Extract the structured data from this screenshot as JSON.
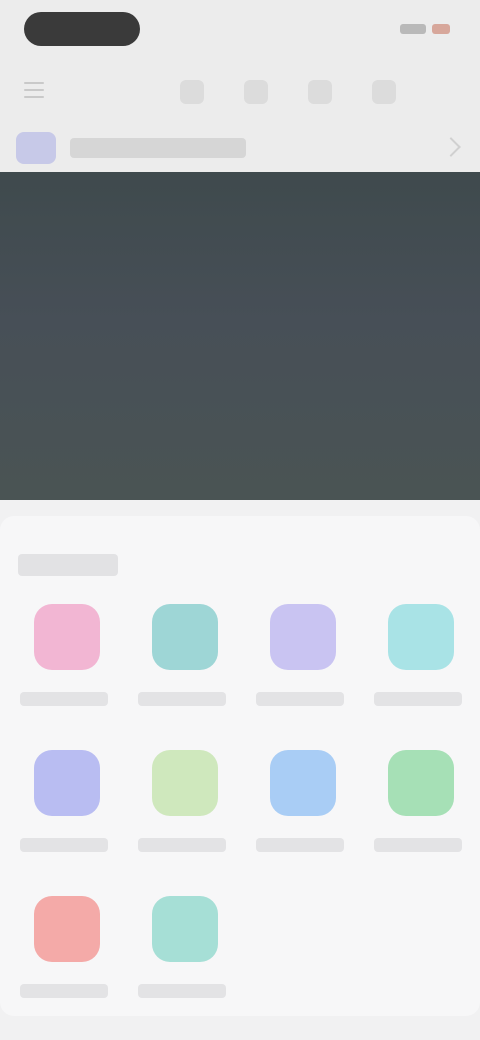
{
  "status_bar": {
    "time": ""
  },
  "account": {
    "name": ""
  },
  "apps_section": {
    "title": ""
  },
  "apps": [
    {
      "label": "",
      "color": "#f2b6d3"
    },
    {
      "label": "",
      "color": "#9ed6d6"
    },
    {
      "label": "",
      "color": "#c9c4f2"
    },
    {
      "label": "",
      "color": "#a9e3e6"
    },
    {
      "label": "",
      "color": "#b9bdf2"
    },
    {
      "label": "",
      "color": "#cfe8bd"
    },
    {
      "label": "",
      "color": "#a9cdf5"
    },
    {
      "label": "",
      "color": "#a6e0b6"
    },
    {
      "label": "",
      "color": "#f4aaa8"
    },
    {
      "label": "",
      "color": "#a6dfd6"
    }
  ],
  "colors": {
    "hero": "#46505a",
    "background": "#f1f1f2"
  }
}
